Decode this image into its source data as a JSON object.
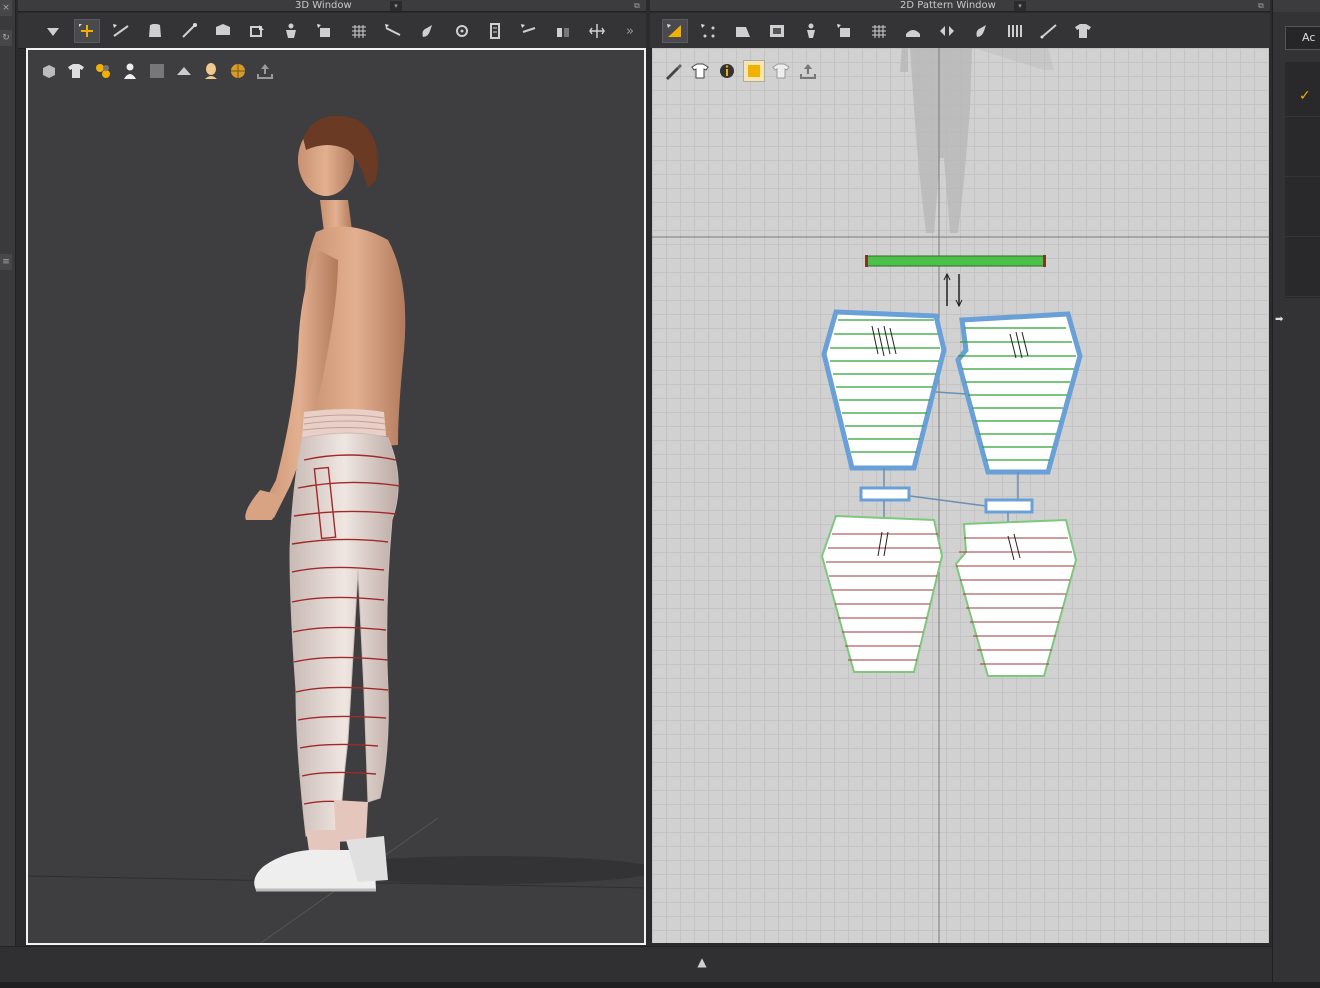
{
  "windows": {
    "three_d": {
      "title": "3D Window"
    },
    "pattern_2d": {
      "title": "2D Pattern Window"
    }
  },
  "left_strip": {
    "close_glyph": "×",
    "refresh_glyph": "↻",
    "list_glyph": "≡"
  },
  "toolbar_3d": {
    "icons": [
      "select-move-icon",
      "transform-icon",
      "edit-line-icon",
      "garment-icon",
      "tack-icon",
      "fold-arrange-icon",
      "reset-icon",
      "avatar-arrange-icon",
      "arrange-points-icon",
      "mesh-icon",
      "sewing-edit-icon",
      "brush-icon",
      "pin-icon",
      "size-measure-icon",
      "flatten-icon",
      "cut-tool-icon",
      "pressure-icon"
    ],
    "overflow_glyph": "»"
  },
  "toolbar_2d": {
    "icons": [
      "transform-pattern-icon",
      "edit-points-icon",
      "polygon-icon",
      "rectangle-icon",
      "internal-shape-icon",
      "seam-icon",
      "grid-fill-icon",
      "trace-icon",
      "flip-icon",
      "free-sewing-icon",
      "segment-sewing-icon",
      "line-tool-icon",
      "shirt-icon"
    ]
  },
  "viewport_3d": {
    "display_icons": [
      "cube-display-icon",
      "shirt-display-icon",
      "fabric-pattern-icon",
      "avatar-icon",
      "shading-icon",
      "texture-icon",
      "skin-icon",
      "globe-icon",
      "export-icon"
    ]
  },
  "viewport_2d": {
    "display_icons": [
      "pen-icon",
      "shirt-outline-icon",
      "info-icon",
      "square-fill-icon",
      "pattern-lock-icon",
      "upload-icon"
    ]
  },
  "right_panel": {
    "tab_label": "Ac",
    "check_glyph": "✓",
    "arrow_glyph": "➡"
  },
  "bottom_bar": {
    "collapse_glyph": "▲"
  },
  "colors": {
    "accent": "#f2b000",
    "selected_pattern": "#6aa0d8",
    "grain_line": "#2aa235",
    "elastic_line": "#a23a3a",
    "waistband": "#4cc14a"
  }
}
